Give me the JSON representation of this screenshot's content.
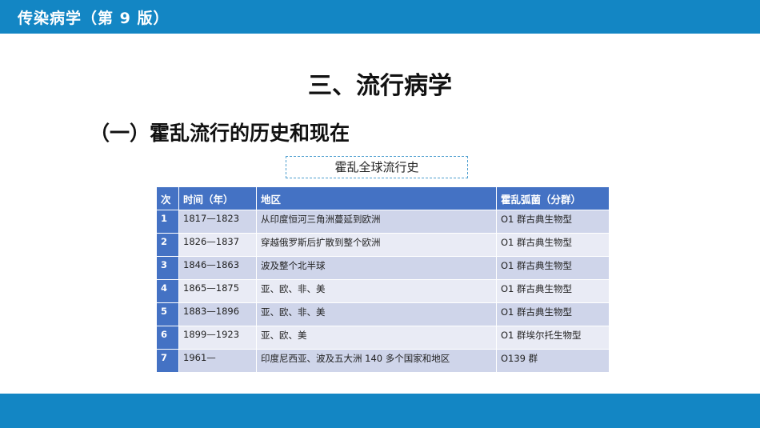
{
  "header": {
    "title": "传染病学（第 9 版）"
  },
  "slide_title": "三、流行病学",
  "section_title": "（一）霍乱流行的历史和现在",
  "caption": "霍乱全球流行史",
  "table": {
    "headers": [
      "次",
      "时间（年）",
      "地区",
      "霍乱弧菌（分群）"
    ],
    "rows": [
      [
        "1",
        "1817—1823",
        "从印度恒河三角洲蔓延到欧洲",
        "O1 群古典生物型"
      ],
      [
        "2",
        "1826—1837",
        "穿越俄罗斯后扩散到整个欧洲",
        "O1 群古典生物型"
      ],
      [
        "3",
        "1846—1863",
        "波及整个北半球",
        "O1 群古典生物型"
      ],
      [
        "4",
        "1865—1875",
        "亚、欧、非、美",
        "O1 群古典生物型"
      ],
      [
        "5",
        "1883—1896",
        "亚、欧、非、美",
        "O1 群古典生物型"
      ],
      [
        "6",
        "1899—1923",
        "亚、欧、美",
        "O1 群埃尔托生物型"
      ],
      [
        "7",
        "1961—",
        "印度尼西亚、波及五大洲 140 多个国家和地区",
        "O139 群"
      ]
    ]
  }
}
